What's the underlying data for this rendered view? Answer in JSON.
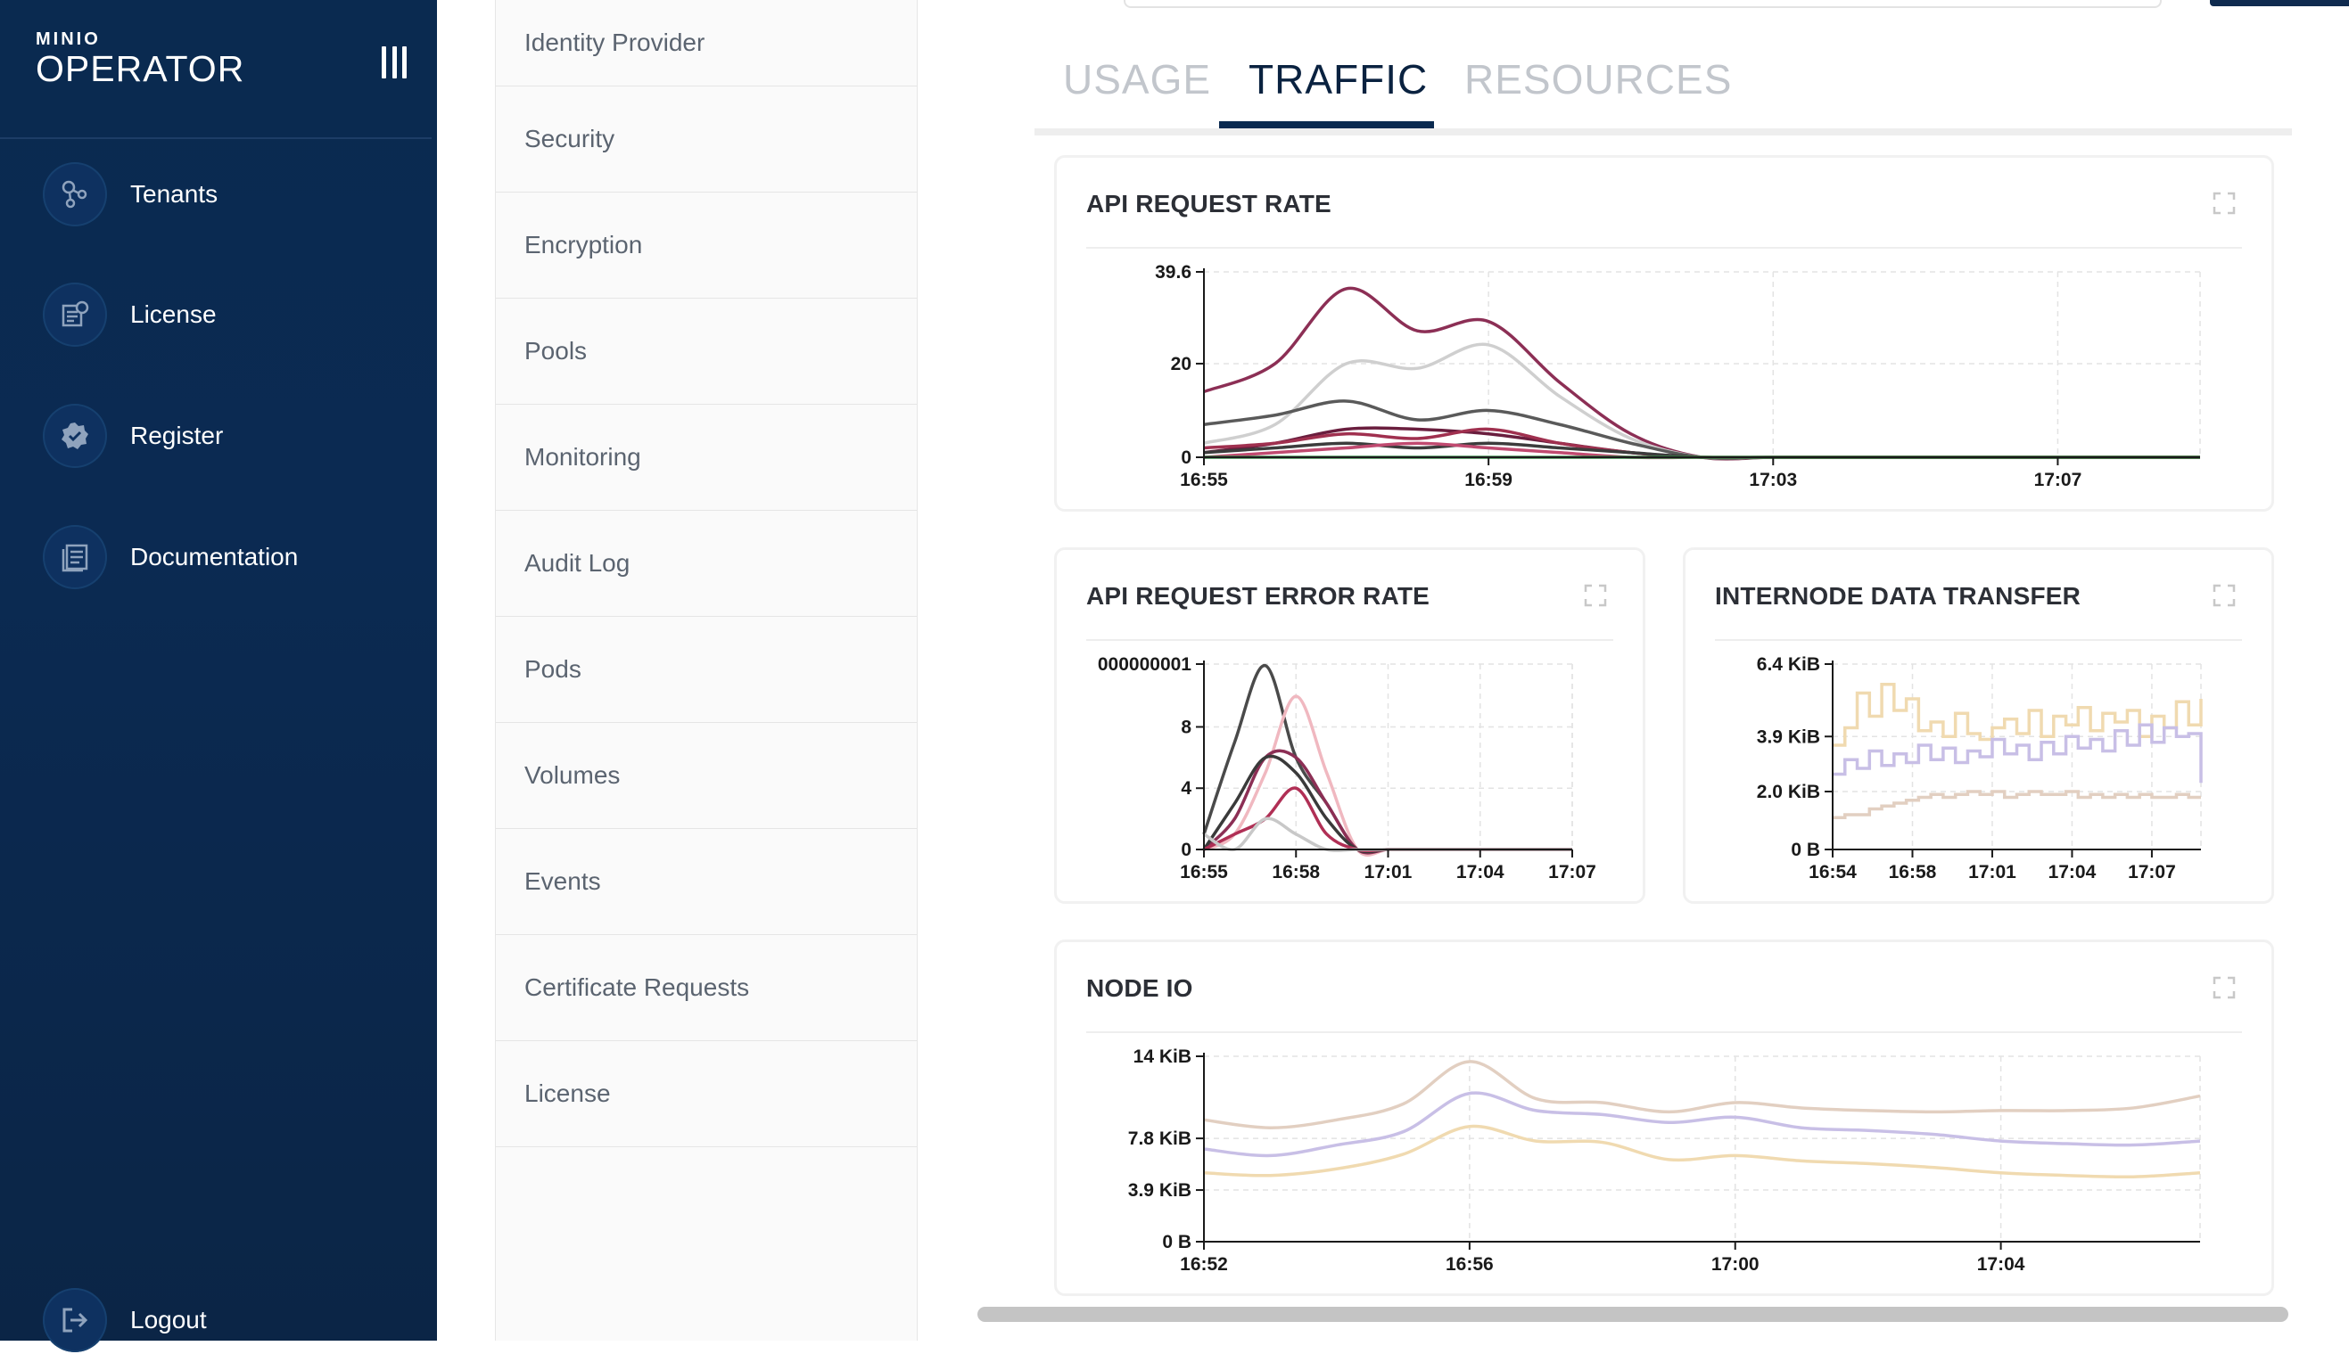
{
  "app": {
    "logo_small": "MINIO",
    "logo_big": "OPERATOR"
  },
  "sidebar": {
    "items": [
      {
        "label": "Tenants",
        "icon": "tenants-icon"
      },
      {
        "label": "License",
        "icon": "license-icon"
      },
      {
        "label": "Register",
        "icon": "register-icon"
      },
      {
        "label": "Documentation",
        "icon": "documentation-icon"
      }
    ],
    "logout": {
      "label": "Logout",
      "icon": "logout-icon"
    }
  },
  "subnav": {
    "items": [
      "Identity Provider",
      "Security",
      "Encryption",
      "Pools",
      "Monitoring",
      "Audit Log",
      "Pods",
      "Volumes",
      "Events",
      "Certificate Requests",
      "License"
    ]
  },
  "tabs": {
    "items": [
      "USAGE",
      "TRAFFIC",
      "RESOURCES"
    ],
    "active": "TRAFFIC"
  },
  "colors": {
    "sidebar_bg": "#0b2a52",
    "accent": "#0a2a50",
    "series_maroon": "#8c2f55",
    "series_gray": "#555555",
    "series_green": "#3a8a4a"
  },
  "cards": {
    "api_request_rate": {
      "title": "API REQUEST RATE",
      "expand_icon": "expand-icon"
    },
    "api_request_error_rate": {
      "title": "API REQUEST ERROR RATE",
      "expand_icon": "expand-icon"
    },
    "internode_data_transfer": {
      "title": "INTERNODE DATA TRANSFER",
      "expand_icon": "expand-icon"
    },
    "node_io": {
      "title": "NODE IO",
      "expand_icon": "expand-icon"
    }
  },
  "chart_data": [
    {
      "id": "api_request_rate",
      "type": "line",
      "title": "API REQUEST RATE",
      "x_ticks": [
        "16:55",
        "16:59",
        "17:03",
        "17:07"
      ],
      "y_ticks": [
        "0",
        "20",
        "39.6"
      ],
      "ylim": [
        0,
        39.6
      ],
      "x": [
        0,
        1,
        2,
        3,
        4,
        5,
        6,
        7,
        8,
        9,
        10,
        11,
        12,
        13,
        14
      ],
      "xlim": [
        0,
        14
      ],
      "grid": true,
      "series": [
        {
          "color": "#8c2f55",
          "values": [
            14,
            20,
            36,
            27,
            29,
            16,
            5,
            0,
            0,
            0,
            0,
            0,
            0,
            0,
            0
          ]
        },
        {
          "color": "#cfcfcf",
          "values": [
            3,
            7,
            20,
            19,
            24,
            13,
            4,
            0,
            0,
            0,
            0,
            0,
            0,
            0,
            0
          ]
        },
        {
          "color": "#5a5a5a",
          "values": [
            7,
            9,
            12,
            8,
            10,
            7,
            3,
            0,
            0,
            0,
            0,
            0,
            0,
            0,
            0
          ]
        },
        {
          "color": "#6a1e3e",
          "values": [
            1,
            3,
            6,
            6,
            5,
            3,
            1,
            0,
            0,
            0,
            0,
            0,
            0,
            0,
            0
          ]
        },
        {
          "color": "#a0304f",
          "values": [
            2,
            3,
            5,
            4,
            6,
            3,
            1,
            0,
            0,
            0,
            0,
            0,
            0,
            0,
            0
          ]
        },
        {
          "color": "#3c3c3c",
          "values": [
            1,
            2,
            3,
            2,
            3,
            2,
            1,
            0,
            0,
            0,
            0,
            0,
            0,
            0,
            0
          ]
        },
        {
          "color": "#c04a70",
          "values": [
            0,
            1,
            2,
            3,
            2,
            1,
            0,
            0,
            0,
            0,
            0,
            0,
            0,
            0,
            0
          ]
        },
        {
          "color": "#3a8a4a",
          "values": [
            0,
            0,
            0,
            0,
            0,
            0,
            0,
            0,
            0,
            0,
            0,
            0,
            0,
            0,
            0
          ]
        }
      ]
    },
    {
      "id": "api_request_error_rate",
      "type": "line",
      "title": "API REQUEST ERROR RATE",
      "x_ticks": [
        "16:55",
        "16:58",
        "17:01",
        "17:04",
        "17:07"
      ],
      "y_ticks": [
        "0",
        "4",
        "8",
        "000000001"
      ],
      "ylim": [
        0,
        12.1
      ],
      "x": [
        0,
        1,
        2,
        3,
        4,
        5,
        6,
        7,
        8,
        9,
        10,
        11,
        12
      ],
      "xlim": [
        0,
        12
      ],
      "grid": true,
      "series": [
        {
          "color": "#4a4a4a",
          "values": [
            1,
            7,
            12,
            6,
            3,
            0,
            0,
            0,
            0,
            0,
            0,
            0,
            0
          ]
        },
        {
          "color": "#f0b8c0",
          "values": [
            0,
            1,
            5,
            10,
            5,
            0,
            0,
            0,
            0,
            0,
            0,
            0,
            0
          ]
        },
        {
          "color": "#8c2f55",
          "values": [
            0,
            2,
            6,
            6,
            3,
            0,
            0,
            0,
            0,
            0,
            0,
            0,
            0
          ]
        },
        {
          "color": "#3a3a3a",
          "values": [
            0,
            3,
            6,
            5,
            2,
            0,
            0,
            0,
            0,
            0,
            0,
            0,
            0
          ]
        },
        {
          "color": "#b02f55",
          "values": [
            0,
            1,
            2,
            4,
            1,
            0,
            0,
            0,
            0,
            0,
            0,
            0,
            0
          ]
        },
        {
          "color": "#c8c8c8",
          "values": [
            1,
            0,
            2,
            1,
            0,
            0,
            0,
            0,
            0,
            0,
            0,
            0,
            0
          ]
        }
      ]
    },
    {
      "id": "internode_data_transfer",
      "type": "line",
      "title": "INTERNODE DATA TRANSFER",
      "x_ticks": [
        "16:54",
        "16:58",
        "17:01",
        "17:04",
        "17:07"
      ],
      "y_ticks": [
        "0 B",
        "2.0 KiB",
        "3.9 KiB",
        "6.4 KiB"
      ],
      "ylim": [
        0,
        6.4
      ],
      "x": [
        0,
        1,
        2,
        3,
        4,
        5,
        6,
        7,
        8,
        9,
        10,
        11,
        12,
        13,
        14,
        15,
        16,
        17,
        18,
        19,
        20,
        21,
        22,
        23,
        24,
        25,
        26,
        27,
        28,
        29,
        30,
        31,
        32
      ],
      "xlim": [
        0,
        30
      ],
      "grid": true,
      "step": true,
      "series": [
        {
          "color": "#f0dab0",
          "values": [
            3.6,
            4.2,
            5.4,
            4.6,
            5.7,
            4.8,
            5.2,
            4.1,
            4.4,
            3.9,
            4.7,
            4.0,
            3.8,
            4.2,
            4.5,
            4.0,
            4.8,
            3.9,
            4.6,
            4.3,
            4.9,
            4.1,
            4.7,
            4.4,
            4.8,
            3.9,
            4.6,
            4.2,
            5.1,
            4.3,
            5.0,
            4.6,
            5.2
          ]
        },
        {
          "color": "#c8bfe6",
          "values": [
            2.6,
            3.1,
            2.8,
            3.4,
            2.9,
            3.3,
            3.0,
            3.6,
            3.1,
            3.5,
            3.0,
            3.4,
            3.2,
            3.8,
            3.3,
            3.6,
            3.1,
            3.7,
            3.3,
            3.9,
            3.5,
            3.8,
            3.4,
            4.1,
            3.6,
            4.3,
            3.7,
            4.2,
            3.9,
            4.0,
            3.7,
            3.5,
            2.3
          ]
        },
        {
          "color": "#e2cfc1",
          "values": [
            1.1,
            1.2,
            1.2,
            1.4,
            1.5,
            1.6,
            1.7,
            1.8,
            1.9,
            1.8,
            1.9,
            2.0,
            1.9,
            2.0,
            1.8,
            1.9,
            2.0,
            1.9,
            1.9,
            2.0,
            1.8,
            1.9,
            1.8,
            1.9,
            1.8,
            1.9,
            1.8,
            1.8,
            1.9,
            1.8,
            1.8,
            1.8,
            1.8
          ]
        }
      ]
    },
    {
      "id": "node_io",
      "type": "line",
      "title": "NODE IO",
      "x_ticks": [
        "16:52",
        "16:56",
        "17:00",
        "17:04"
      ],
      "y_ticks": [
        "0 B",
        "3.9 KiB",
        "7.8 KiB",
        "14 KiB"
      ],
      "ylim": [
        0,
        14
      ],
      "x": [
        0,
        1,
        2,
        3,
        4,
        5,
        6,
        7,
        8,
        9,
        10,
        11,
        12,
        13,
        14,
        15
      ],
      "xlim": [
        0,
        15
      ],
      "grid": true,
      "series": [
        {
          "color": "#e2cfc1",
          "values": [
            9.2,
            8.6,
            9.2,
            10.4,
            13.6,
            10.8,
            10.5,
            9.8,
            10.5,
            10.1,
            9.9,
            9.8,
            9.9,
            9.9,
            10.1,
            11
          ]
        },
        {
          "color": "#c8bfe6",
          "values": [
            7,
            6.5,
            7.3,
            8.3,
            11.2,
            9.9,
            9.6,
            9,
            9.4,
            8.6,
            8.4,
            8.1,
            7.6,
            7.4,
            7.3,
            7.6
          ]
        },
        {
          "color": "#f0dab0",
          "values": [
            5.2,
            5,
            5.5,
            6.6,
            8.7,
            7.6,
            7.5,
            6.2,
            6.5,
            6.1,
            5.9,
            5.6,
            5.2,
            5,
            4.9,
            5.2
          ]
        }
      ]
    }
  ]
}
